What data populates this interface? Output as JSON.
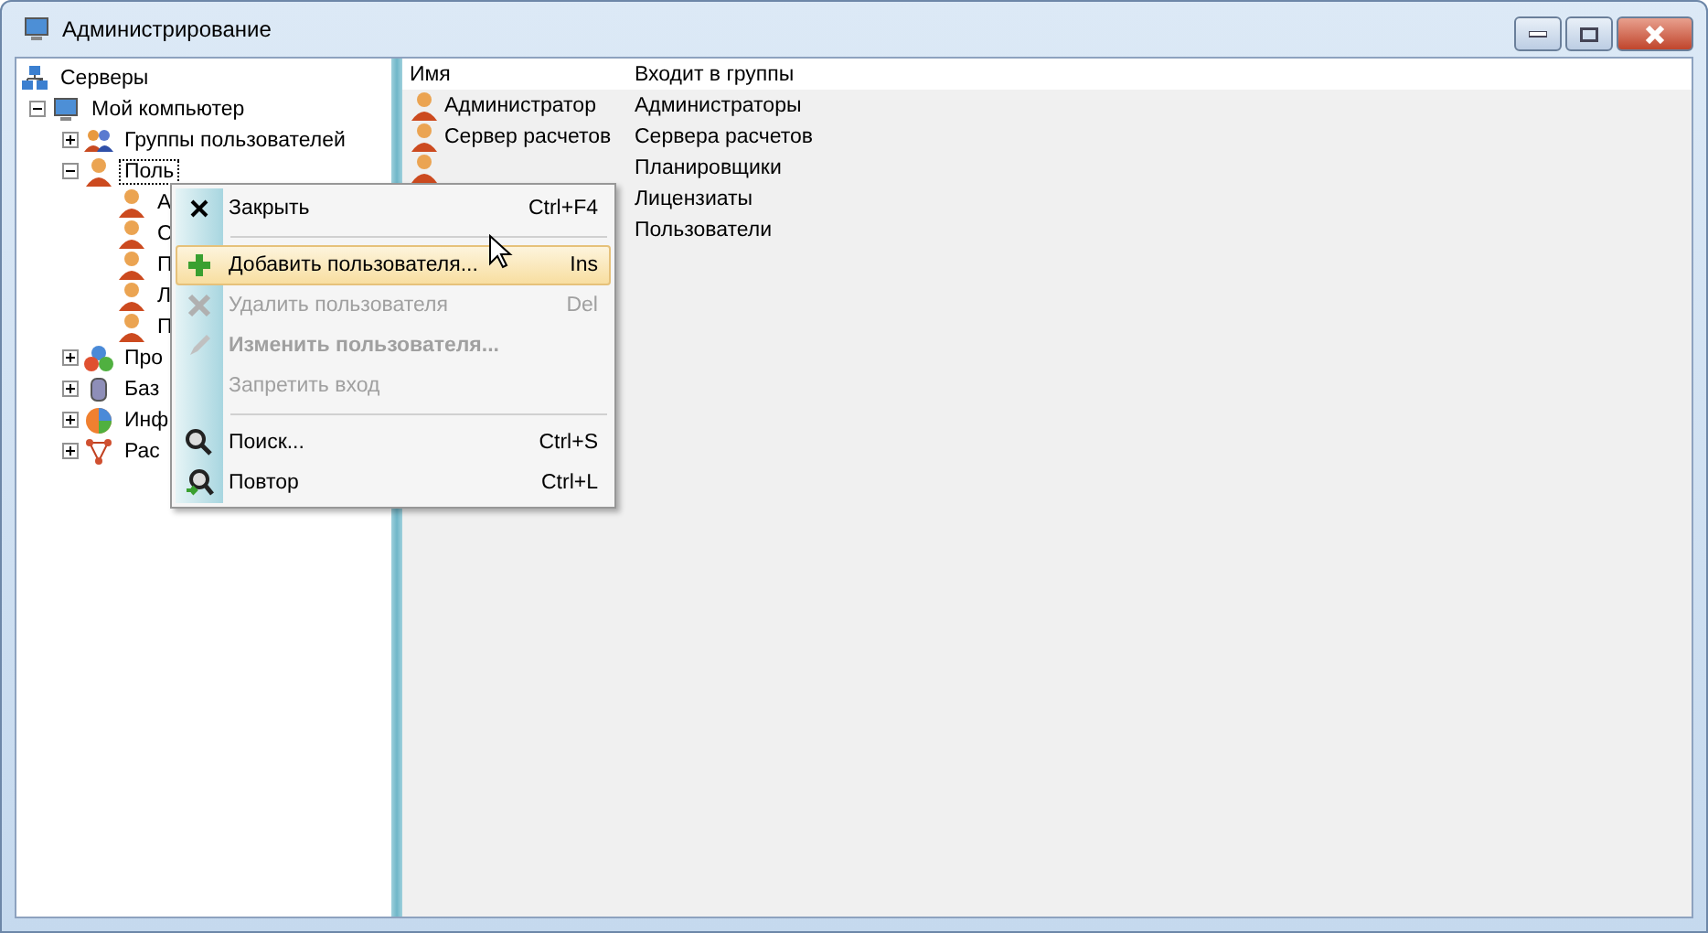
{
  "window": {
    "title": "Администрирование"
  },
  "tree": [
    {
      "label": "Серверы",
      "kind": "servers",
      "children": [
        {
          "label": "Мой компьютер",
          "kind": "computer",
          "expanded": true,
          "selected": false,
          "children": [
            {
              "label": "Группы пользователей",
              "kind": "group",
              "expanded": false,
              "selected": false
            },
            {
              "label": "Поль",
              "kind": "user",
              "expanded": true,
              "selected": true,
              "children": [
                {
                  "label": "А",
                  "kind": "user",
                  "selected": false
                },
                {
                  "label": "С",
                  "kind": "user",
                  "selected": false
                },
                {
                  "label": "П",
                  "kind": "user",
                  "selected": false
                },
                {
                  "label": "Л",
                  "kind": "user",
                  "selected": false
                },
                {
                  "label": "П",
                  "kind": "user",
                  "selected": false
                }
              ]
            },
            {
              "label": "Про",
              "kind": "process",
              "expanded": false,
              "selected": false
            },
            {
              "label": "Баз",
              "kind": "database",
              "expanded": false,
              "selected": false
            },
            {
              "label": "Инф",
              "kind": "info",
              "expanded": false,
              "selected": false
            },
            {
              "label": "Рас",
              "kind": "network",
              "expanded": false,
              "selected": false
            }
          ]
        }
      ]
    }
  ],
  "table": {
    "columns": [
      "Имя",
      "Входит в группы"
    ],
    "rows": [
      {
        "name": "Администратор",
        "groups": "Администраторы"
      },
      {
        "name": "Сервер расчетов",
        "groups": "Сервера расчетов"
      },
      {
        "groups": "Планировщики"
      },
      {
        "groups": "Лицензиаты"
      },
      {
        "groups": "Пользователи"
      }
    ]
  },
  "context_menu": [
    {
      "kind": "close",
      "label": "Закрыть",
      "shortcut": "Ctrl+F4",
      "disabled": false,
      "selected": false
    },
    {
      "kind": "separator"
    },
    {
      "kind": "add",
      "label": "Добавить пользователя...",
      "shortcut": "Ins",
      "disabled": false,
      "selected": true
    },
    {
      "kind": "delete",
      "label": "Удалить пользователя",
      "shortcut": "Del",
      "disabled": true,
      "selected": false
    },
    {
      "kind": "edit",
      "label": "Изменить пользователя...",
      "disabled": true,
      "selected": false
    },
    {
      "kind": "plain",
      "label": "Запретить вход",
      "disabled": true,
      "selected": false
    },
    {
      "kind": "separator"
    },
    {
      "kind": "search",
      "label": "Поиск...",
      "shortcut": "Ctrl+S",
      "disabled": false,
      "selected": false
    },
    {
      "kind": "repeat",
      "label": "Повтор",
      "shortcut": "Ctrl+L",
      "disabled": false,
      "selected": false
    }
  ]
}
